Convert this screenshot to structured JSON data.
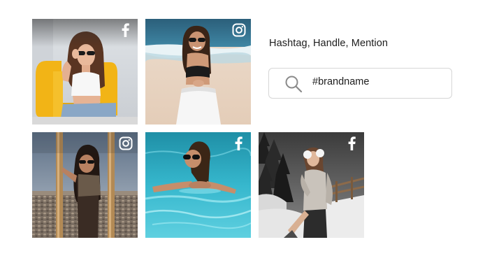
{
  "colors": {
    "text": "#1c1c1c",
    "input_border": "#d6d6d6",
    "icon_gray": "#8a8a8a",
    "background": "#ffffff"
  },
  "feed": {
    "tiles": [
      {
        "source": "facebook",
        "icon": "facebook-icon",
        "scene": "woman in sunglasses on yellow armchair"
      },
      {
        "source": "instagram",
        "icon": "instagram-icon",
        "scene": "woman in black top on beach"
      },
      {
        "source": "instagram",
        "icon": "instagram-icon",
        "scene": "woman leaning in doorway by pebble shore"
      },
      {
        "source": "facebook",
        "icon": "facebook-icon",
        "scene": "woman in sunglasses in swimming pool"
      },
      {
        "source": "facebook",
        "icon": "facebook-icon",
        "scene": "woman in white earmuffs on snowy path"
      }
    ]
  },
  "panel": {
    "label": "Hashtag, Handle, Mention",
    "search": {
      "icon": "search-icon",
      "value": "#brandname"
    }
  }
}
